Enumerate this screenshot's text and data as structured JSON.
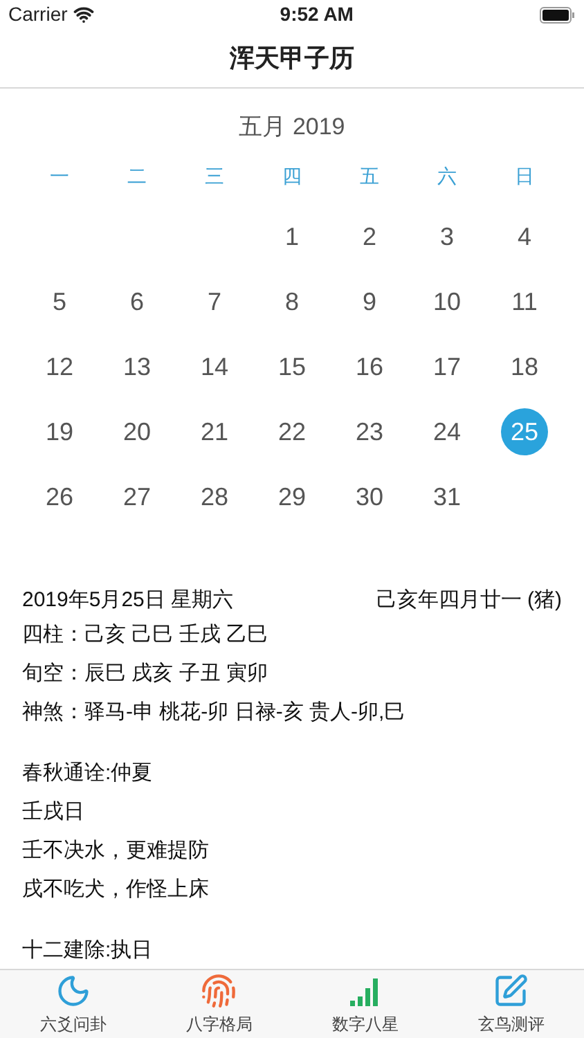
{
  "status_bar": {
    "carrier": "Carrier",
    "time": "9:52 AM"
  },
  "nav_title": "浑天甲子历",
  "calendar": {
    "month_title": "五月 2019",
    "weekdays": [
      "一",
      "二",
      "三",
      "四",
      "五",
      "六",
      "日"
    ],
    "weeks": [
      [
        {
          "day": "1",
          "selected": false
        },
        {
          "day": "2",
          "selected": false
        },
        {
          "day": "3",
          "selected": false
        },
        {
          "day": "4",
          "selected": false
        }
      ],
      [
        {
          "day": "5",
          "selected": false
        },
        {
          "day": "6",
          "selected": false
        },
        {
          "day": "7",
          "selected": false
        },
        {
          "day": "8",
          "selected": false
        },
        {
          "day": "9",
          "selected": false
        },
        {
          "day": "10",
          "selected": false
        },
        {
          "day": "11",
          "selected": false
        }
      ],
      [
        {
          "day": "12",
          "selected": false
        },
        {
          "day": "13",
          "selected": false
        },
        {
          "day": "14",
          "selected": false
        },
        {
          "day": "15",
          "selected": false
        },
        {
          "day": "16",
          "selected": false
        },
        {
          "day": "17",
          "selected": false
        },
        {
          "day": "18",
          "selected": false
        }
      ],
      [
        {
          "day": "19",
          "selected": false
        },
        {
          "day": "20",
          "selected": false
        },
        {
          "day": "21",
          "selected": false
        },
        {
          "day": "22",
          "selected": false
        },
        {
          "day": "23",
          "selected": false
        },
        {
          "day": "24",
          "selected": false
        },
        {
          "day": "25",
          "selected": true
        }
      ],
      [
        {
          "day": "26",
          "selected": false
        },
        {
          "day": "27",
          "selected": false
        },
        {
          "day": "28",
          "selected": false
        },
        {
          "day": "29",
          "selected": false
        },
        {
          "day": "30",
          "selected": false
        },
        {
          "day": "31",
          "selected": false
        }
      ]
    ]
  },
  "details": {
    "date": "2019年5月25日 星期六",
    "lunar_date": "己亥年四月廿一 (猪)",
    "groups": [
      [
        "四柱：己亥 己巳 壬戌 乙巳",
        "旬空：辰巳 戌亥 子丑 寅卯",
        "神煞：驿马-申 桃花-卯 日禄-亥 贵人-卯,巳"
      ],
      [
        "春秋通诠:仲夏",
        "壬戌日",
        "壬不决水，更难提防",
        "戌不吃犬，作怪上床"
      ],
      [
        "十二建除:执日"
      ]
    ]
  },
  "tab_bar": [
    {
      "kind": "moon",
      "label": "六爻问卦",
      "color": "#2f9fd8"
    },
    {
      "kind": "fingerprint",
      "label": "八字格局",
      "color": "#ef6a3a"
    },
    {
      "kind": "signal",
      "label": "数字八星",
      "color": "#27ae60"
    },
    {
      "kind": "edit",
      "label": "玄鸟测评",
      "color": "#2f9fd8"
    }
  ]
}
